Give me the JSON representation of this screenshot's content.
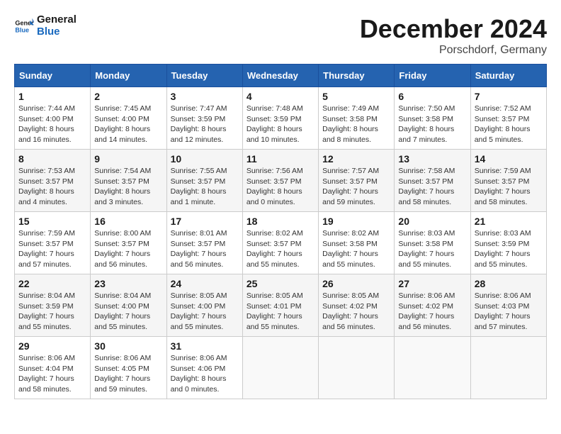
{
  "header": {
    "logo_line1": "General",
    "logo_line2": "Blue",
    "month_year": "December 2024",
    "location": "Porschdorf, Germany"
  },
  "weekdays": [
    "Sunday",
    "Monday",
    "Tuesday",
    "Wednesday",
    "Thursday",
    "Friday",
    "Saturday"
  ],
  "weeks": [
    [
      {
        "day": "1",
        "sunrise": "7:44 AM",
        "sunset": "4:00 PM",
        "daylight": "8 hours and 16 minutes."
      },
      {
        "day": "2",
        "sunrise": "7:45 AM",
        "sunset": "4:00 PM",
        "daylight": "8 hours and 14 minutes."
      },
      {
        "day": "3",
        "sunrise": "7:47 AM",
        "sunset": "3:59 PM",
        "daylight": "8 hours and 12 minutes."
      },
      {
        "day": "4",
        "sunrise": "7:48 AM",
        "sunset": "3:59 PM",
        "daylight": "8 hours and 10 minutes."
      },
      {
        "day": "5",
        "sunrise": "7:49 AM",
        "sunset": "3:58 PM",
        "daylight": "8 hours and 8 minutes."
      },
      {
        "day": "6",
        "sunrise": "7:50 AM",
        "sunset": "3:58 PM",
        "daylight": "8 hours and 7 minutes."
      },
      {
        "day": "7",
        "sunrise": "7:52 AM",
        "sunset": "3:57 PM",
        "daylight": "8 hours and 5 minutes."
      }
    ],
    [
      {
        "day": "8",
        "sunrise": "7:53 AM",
        "sunset": "3:57 PM",
        "daylight": "8 hours and 4 minutes."
      },
      {
        "day": "9",
        "sunrise": "7:54 AM",
        "sunset": "3:57 PM",
        "daylight": "8 hours and 3 minutes."
      },
      {
        "day": "10",
        "sunrise": "7:55 AM",
        "sunset": "3:57 PM",
        "daylight": "8 hours and 1 minute."
      },
      {
        "day": "11",
        "sunrise": "7:56 AM",
        "sunset": "3:57 PM",
        "daylight": "8 hours and 0 minutes."
      },
      {
        "day": "12",
        "sunrise": "7:57 AM",
        "sunset": "3:57 PM",
        "daylight": "7 hours and 59 minutes."
      },
      {
        "day": "13",
        "sunrise": "7:58 AM",
        "sunset": "3:57 PM",
        "daylight": "7 hours and 58 minutes."
      },
      {
        "day": "14",
        "sunrise": "7:59 AM",
        "sunset": "3:57 PM",
        "daylight": "7 hours and 58 minutes."
      }
    ],
    [
      {
        "day": "15",
        "sunrise": "7:59 AM",
        "sunset": "3:57 PM",
        "daylight": "7 hours and 57 minutes."
      },
      {
        "day": "16",
        "sunrise": "8:00 AM",
        "sunset": "3:57 PM",
        "daylight": "7 hours and 56 minutes."
      },
      {
        "day": "17",
        "sunrise": "8:01 AM",
        "sunset": "3:57 PM",
        "daylight": "7 hours and 56 minutes."
      },
      {
        "day": "18",
        "sunrise": "8:02 AM",
        "sunset": "3:57 PM",
        "daylight": "7 hours and 55 minutes."
      },
      {
        "day": "19",
        "sunrise": "8:02 AM",
        "sunset": "3:58 PM",
        "daylight": "7 hours and 55 minutes."
      },
      {
        "day": "20",
        "sunrise": "8:03 AM",
        "sunset": "3:58 PM",
        "daylight": "7 hours and 55 minutes."
      },
      {
        "day": "21",
        "sunrise": "8:03 AM",
        "sunset": "3:59 PM",
        "daylight": "7 hours and 55 minutes."
      }
    ],
    [
      {
        "day": "22",
        "sunrise": "8:04 AM",
        "sunset": "3:59 PM",
        "daylight": "7 hours and 55 minutes."
      },
      {
        "day": "23",
        "sunrise": "8:04 AM",
        "sunset": "4:00 PM",
        "daylight": "7 hours and 55 minutes."
      },
      {
        "day": "24",
        "sunrise": "8:05 AM",
        "sunset": "4:00 PM",
        "daylight": "7 hours and 55 minutes."
      },
      {
        "day": "25",
        "sunrise": "8:05 AM",
        "sunset": "4:01 PM",
        "daylight": "7 hours and 55 minutes."
      },
      {
        "day": "26",
        "sunrise": "8:05 AM",
        "sunset": "4:02 PM",
        "daylight": "7 hours and 56 minutes."
      },
      {
        "day": "27",
        "sunrise": "8:06 AM",
        "sunset": "4:02 PM",
        "daylight": "7 hours and 56 minutes."
      },
      {
        "day": "28",
        "sunrise": "8:06 AM",
        "sunset": "4:03 PM",
        "daylight": "7 hours and 57 minutes."
      }
    ],
    [
      {
        "day": "29",
        "sunrise": "8:06 AM",
        "sunset": "4:04 PM",
        "daylight": "7 hours and 58 minutes."
      },
      {
        "day": "30",
        "sunrise": "8:06 AM",
        "sunset": "4:05 PM",
        "daylight": "7 hours and 59 minutes."
      },
      {
        "day": "31",
        "sunrise": "8:06 AM",
        "sunset": "4:06 PM",
        "daylight": "8 hours and 0 minutes."
      },
      null,
      null,
      null,
      null
    ]
  ],
  "labels": {
    "sunrise_prefix": "Sunrise: ",
    "sunset_prefix": "Sunset: ",
    "daylight_prefix": "Daylight: "
  }
}
